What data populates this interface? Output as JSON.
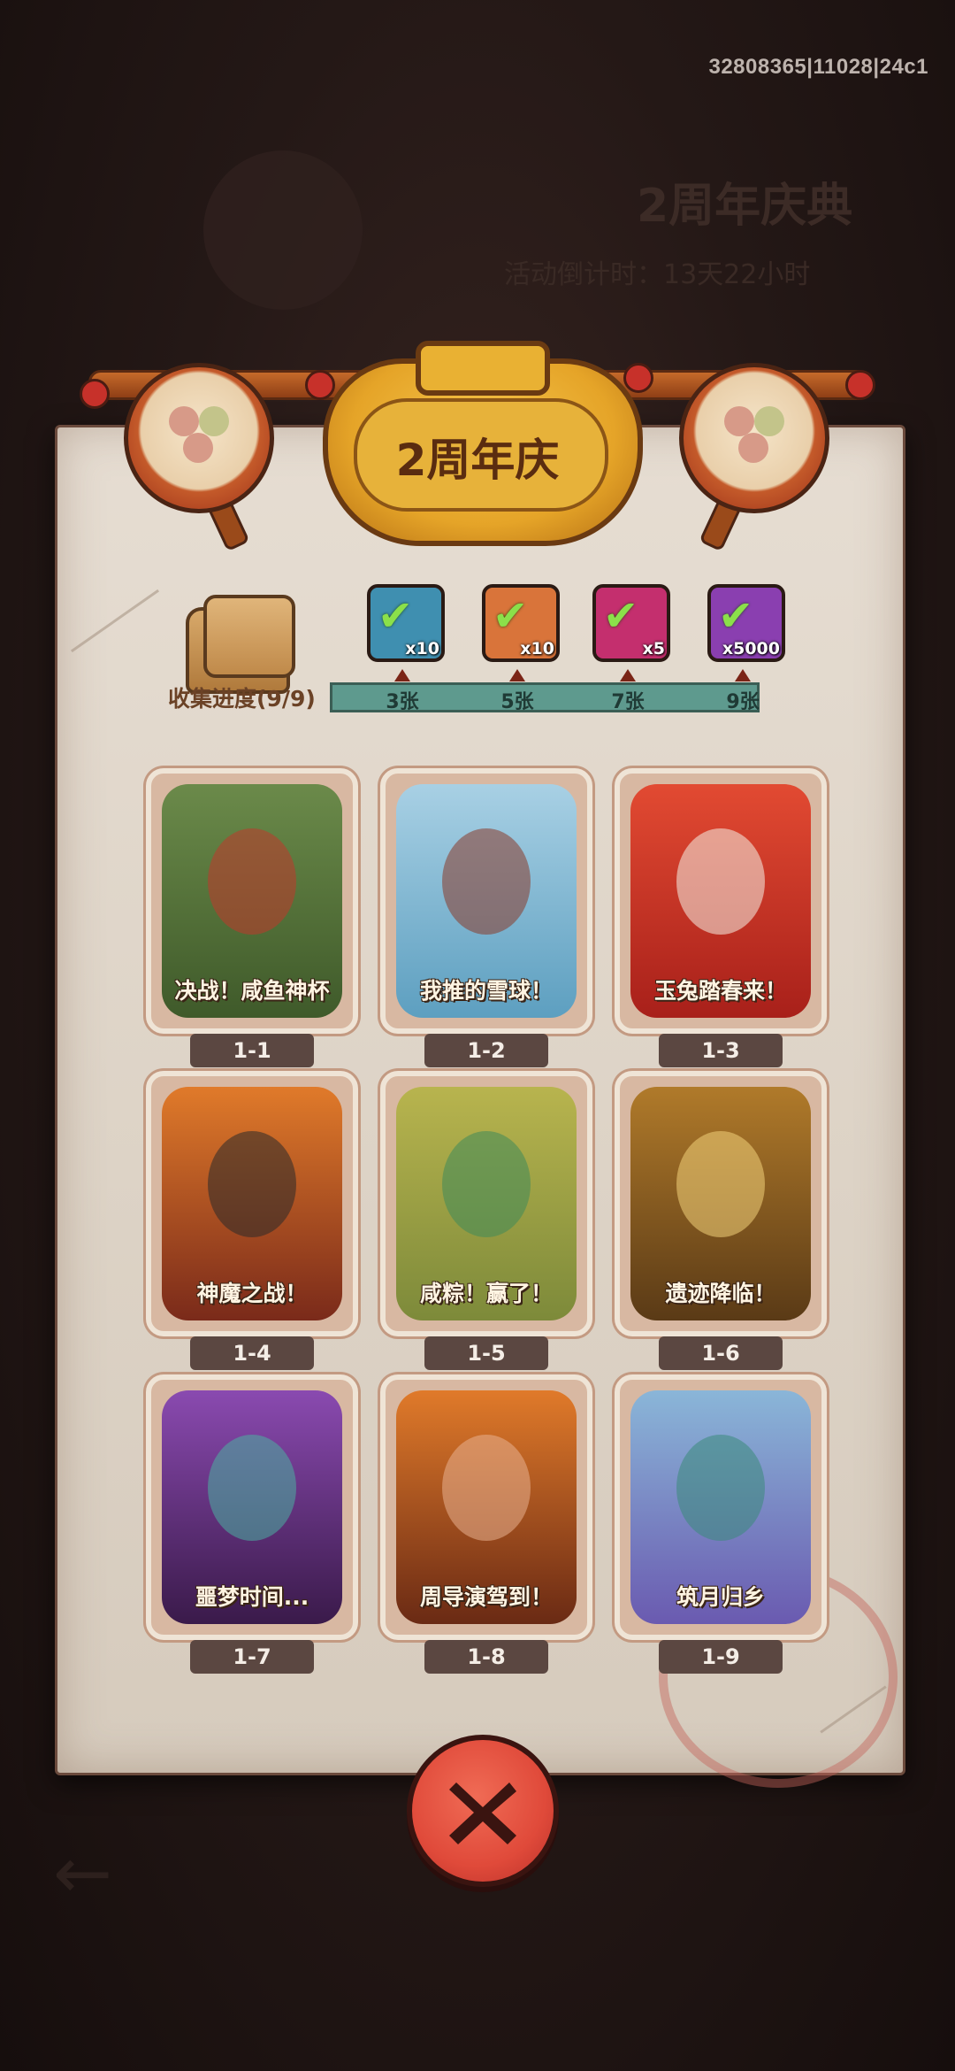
{
  "system": {
    "build_id": "32808365|11028|24c1"
  },
  "background": {
    "event_title": "2周年庆典",
    "countdown_text": "活动倒计时：13天22小时"
  },
  "panel": {
    "title": "2周年庆"
  },
  "progress": {
    "label": "收集进度(9/9)",
    "collected": 9,
    "total": 9,
    "rewards": [
      {
        "icon": "treasure-chest-icon",
        "count": "x10",
        "color": "#3f8fb0",
        "milestone": "3张",
        "claimed": true
      },
      {
        "icon": "golden-key-icon",
        "count": "x10",
        "color": "#d9743a",
        "milestone": "5张",
        "claimed": true
      },
      {
        "icon": "purple-orb-icon",
        "count": "x5",
        "color": "#c42f6e",
        "milestone": "7张",
        "claimed": true
      },
      {
        "icon": "silver-ingot-icon",
        "count": "x5000",
        "color": "#8a3fb0",
        "milestone": "9张",
        "claimed": true
      }
    ]
  },
  "cards": [
    {
      "title": "决战！咸鱼神杯",
      "number": "1-1",
      "color_top": "#6b8a4a",
      "color_bottom": "#3f5a2a",
      "accent": "#c0392b"
    },
    {
      "title": "我推的雪球！",
      "number": "1-2",
      "color_top": "#a8d0e4",
      "color_bottom": "#5d9fc0",
      "accent": "#8a3a2a"
    },
    {
      "title": "玉兔踏春来！",
      "number": "1-3",
      "color_top": "#e24a32",
      "color_bottom": "#a8201a",
      "accent": "#f4f1e6"
    },
    {
      "title": "神魔之战！",
      "number": "1-4",
      "color_top": "#e07a2a",
      "color_bottom": "#7a2a1a",
      "accent": "#2a2a2a"
    },
    {
      "title": "咸粽！赢了！",
      "number": "1-5",
      "color_top": "#b8b44e",
      "color_bottom": "#7d8a3a",
      "accent": "#3f8a5a"
    },
    {
      "title": "遗迹降临！",
      "number": "1-6",
      "color_top": "#b07a2a",
      "color_bottom": "#5a3a16",
      "accent": "#f2d27a"
    },
    {
      "title": "噩梦时间...",
      "number": "1-7",
      "color_top": "#8a4ab0",
      "color_bottom": "#3a1a4a",
      "accent": "#4ab0a0"
    },
    {
      "title": "周导演驾到！",
      "number": "1-8",
      "color_top": "#e07a2a",
      "color_bottom": "#6a2a14",
      "accent": "#e8b090"
    },
    {
      "title": "筑月归乡",
      "number": "1-9",
      "color_top": "#8ab6d8",
      "color_bottom": "#6a5ab0",
      "accent": "#3a8a7a"
    }
  ]
}
